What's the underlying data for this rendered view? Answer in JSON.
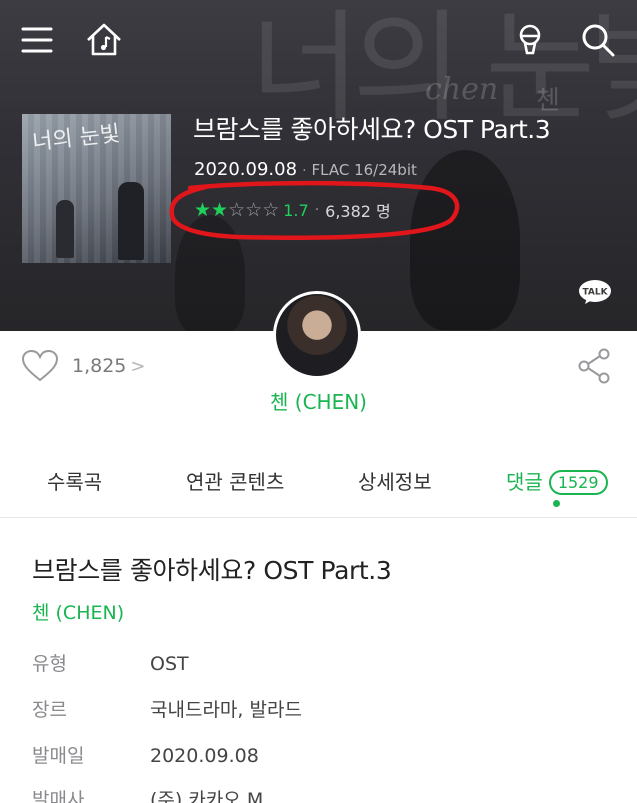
{
  "header": {
    "menu_icon": "hamburger-menu-icon",
    "home_icon": "music-home-icon",
    "mic_icon": "microphone-icon",
    "search_icon": "search-icon"
  },
  "album": {
    "cover_text": "너의 눈빛",
    "title": "브람스를 좋아하세요? OST Part.3",
    "release_date": "2020.09.08",
    "format": "FLAC 16/24bit",
    "rating": {
      "stars_filled": 2,
      "stars_total": 5,
      "score": "1.7",
      "participants": "6,382 명"
    },
    "talk_label": "TALK"
  },
  "social": {
    "like_count": "1,825",
    "like_chevron": ">",
    "artist": "첸 (CHEN)"
  },
  "tabs": [
    {
      "label": "수록곡"
    },
    {
      "label": "연관 콘텐츠"
    },
    {
      "label": "상세정보"
    },
    {
      "label": "댓글",
      "badge": "1529"
    }
  ],
  "detail": {
    "title": "브람스를 좋아하세요? OST Part.3",
    "artist": "첸 (CHEN)",
    "rows": [
      {
        "key": "유형",
        "value": "OST"
      },
      {
        "key": "장르",
        "value": "국내드라마, 발라드"
      },
      {
        "key": "발매일",
        "value": "2020.09.08"
      },
      {
        "key": "발매사",
        "value": "(주) 카카오 M"
      }
    ]
  },
  "colors": {
    "accent_green": "#1ab551",
    "star_green": "#1fd05b",
    "highlight_red": "#e0161b"
  }
}
